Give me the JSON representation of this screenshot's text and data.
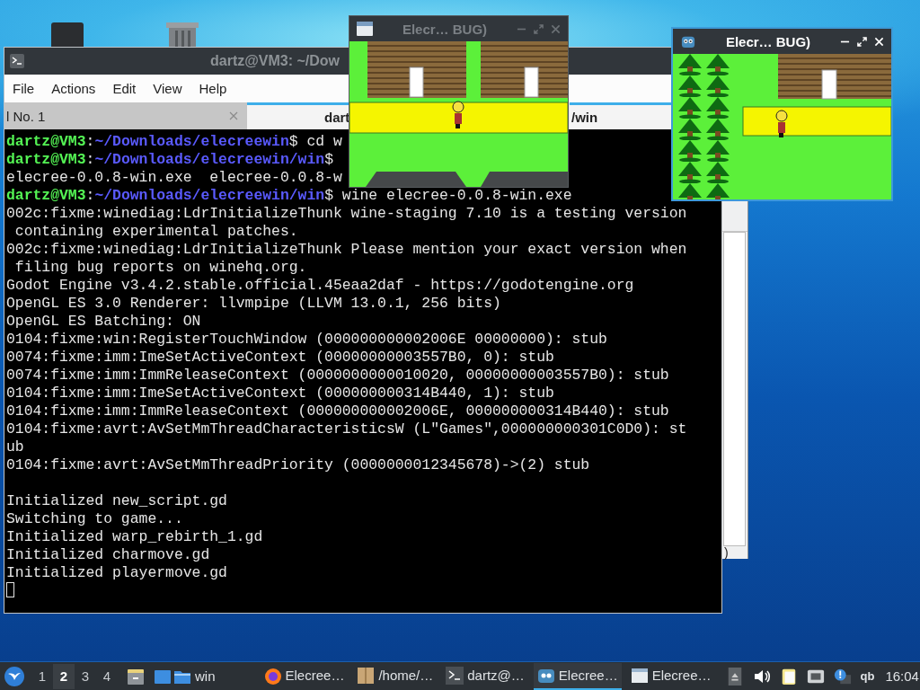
{
  "background_window": {
    "text": ")"
  },
  "terminal": {
    "title": "dartz@VM3: ~/Dow",
    "menu": [
      "File",
      "Actions",
      "Edit",
      "View",
      "Help"
    ],
    "tabs": [
      {
        "label": "l No. 1",
        "selected": false
      },
      {
        "label": "dart",
        "label_end": "/win",
        "selected": true
      }
    ],
    "lines": [
      {
        "kind": "prompt",
        "user": "dartz@VM3",
        "colon": ":",
        "path": "~/Downloads/elecreewin",
        "rest": "$ cd w"
      },
      {
        "kind": "prompt",
        "user": "dartz@VM3",
        "colon": ":",
        "path": "~/Downloads/elecreewin/win",
        "rest": "$"
      },
      {
        "kind": "output",
        "text": "elecree-0.0.8-win.exe  elecree-0.0.8-w"
      },
      {
        "kind": "prompt",
        "user": "dartz@VM3",
        "colon": ":",
        "path": "~/Downloads/elecreewin/win",
        "rest": "$ wine elecree-0.0.8-win.exe"
      },
      {
        "kind": "output",
        "text": "002c:fixme:winediag:LdrInitializeThunk wine-staging 7.10 is a testing version"
      },
      {
        "kind": "output",
        "text": " containing experimental patches."
      },
      {
        "kind": "output",
        "text": "002c:fixme:winediag:LdrInitializeThunk Please mention your exact version when"
      },
      {
        "kind": "output",
        "text": " filing bug reports on winehq.org."
      },
      {
        "kind": "output",
        "text": "Godot Engine v3.4.2.stable.official.45eaa2daf - https://godotengine.org"
      },
      {
        "kind": "output",
        "text": "OpenGL ES 3.0 Renderer: llvmpipe (LLVM 13.0.1, 256 bits)"
      },
      {
        "kind": "output",
        "text": "OpenGL ES Batching: ON"
      },
      {
        "kind": "output",
        "text": "0104:fixme:win:RegisterTouchWindow (000000000002006E 00000000): stub"
      },
      {
        "kind": "output",
        "text": "0074:fixme:imm:ImeSetActiveContext (00000000003557B0, 0): stub"
      },
      {
        "kind": "output",
        "text": "0074:fixme:imm:ImmReleaseContext (0000000000010020, 00000000003557B0): stub"
      },
      {
        "kind": "output",
        "text": "0104:fixme:imm:ImeSetActiveContext (000000000314B440, 1): stub"
      },
      {
        "kind": "output",
        "text": "0104:fixme:imm:ImmReleaseContext (000000000002006E, 000000000314B440): stub"
      },
      {
        "kind": "output",
        "text": "0104:fixme:avrt:AvSetMmThreadCharacteristicsW (L\"Games\",000000000301C0D0): st"
      },
      {
        "kind": "output",
        "text": "ub"
      },
      {
        "kind": "output",
        "text": "0104:fixme:avrt:AvSetMmThreadPriority (0000000012345678)->(2) stub"
      },
      {
        "kind": "blank"
      },
      {
        "kind": "output",
        "text": "Initialized new_script.gd"
      },
      {
        "kind": "output",
        "text": "Switching to game..."
      },
      {
        "kind": "output",
        "text": "Initialized warp_rebirth_1.gd"
      },
      {
        "kind": "output",
        "text": "Initialized charmove.gd"
      },
      {
        "kind": "output",
        "text": "Initialized playermove.gd"
      },
      {
        "kind": "cursor"
      }
    ]
  },
  "game_windows": [
    {
      "title": "Elecr… BUG)",
      "active": false
    },
    {
      "title": "Elecr… BUG)",
      "active": true
    }
  ],
  "taskbar": {
    "workspaces": [
      {
        "label": "1",
        "selected": false
      },
      {
        "label": "2",
        "selected": true
      },
      {
        "label": "3",
        "selected": false
      },
      {
        "label": "4",
        "selected": false
      }
    ],
    "launchers": [
      {
        "kind": "cabinet"
      },
      {
        "kind": "window"
      },
      {
        "kind": "folder",
        "label": "win"
      }
    ],
    "tasks": [
      {
        "kind": "browser",
        "label": "Elecree…",
        "selected": false
      },
      {
        "kind": "archive",
        "label": "/home/…",
        "selected": false
      },
      {
        "kind": "terminal",
        "label": "dartz@…",
        "selected": false
      },
      {
        "kind": "engine",
        "label": "Elecree…",
        "selected": true
      },
      {
        "kind": "window",
        "label": "Elecree…",
        "selected": false
      }
    ],
    "tray": [
      {
        "kind": "eject"
      },
      {
        "kind": "volume"
      },
      {
        "kind": "clipboard"
      },
      {
        "kind": "network"
      },
      {
        "kind": "notice"
      },
      {
        "kind": "text",
        "label": "qb"
      }
    ],
    "clock": "16:04"
  }
}
